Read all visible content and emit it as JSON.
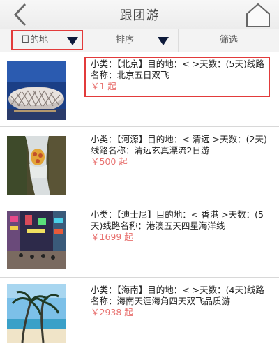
{
  "header": {
    "title": "跟团游"
  },
  "filters": [
    {
      "label": "目的地"
    },
    {
      "label": "排序"
    },
    {
      "label": "筛选"
    }
  ],
  "items": [
    {
      "line1": "小类：【北京】目的地：< >天数：(5天)线路名称：北京五日双飞",
      "price": "￥1 起",
      "image": "bird-nest-stadium"
    },
    {
      "line1": "小类：【河源】目的地：< 清远 >天数：(2天)线路名称：清远玄真漂流2日游",
      "price": "￥500 起",
      "image": "rafting"
    },
    {
      "line1": "小类：【迪士尼】目的地：< 香港 >天数：(5天)线路名称：港澳五天四星海洋线",
      "price": "￥1699 起",
      "image": "hong-kong-street"
    },
    {
      "line1": "小类：【海南】目的地：< >天数：(4天)线路名称：海南天涯海角四天双飞品质游",
      "price": "￥2938 起",
      "image": "palm-beach"
    }
  ]
}
